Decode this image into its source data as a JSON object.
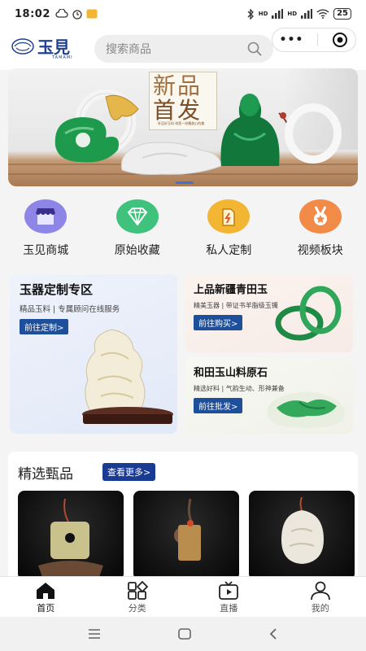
{
  "status_bar": {
    "time": "18:02",
    "battery": "25",
    "net1": "HD",
    "net2": "HD"
  },
  "header": {
    "logo_text": "玉見",
    "logo_sub": "TAMAMI",
    "search_placeholder": "搜索商品",
    "capsule_more": "•••"
  },
  "banner": {
    "title_line1": "新品",
    "title_line2": "首发",
    "tagline": "轩品好玉料 给您一份最放心的美"
  },
  "quick_nav": [
    {
      "label": "玉见商城",
      "icon": "shop-icon",
      "color": "#8d86e6"
    },
    {
      "label": "原始收藏",
      "icon": "diamond-icon",
      "color": "#3fc27b"
    },
    {
      "label": "私人定制",
      "icon": "tag-icon",
      "color": "#f2b632"
    },
    {
      "label": "视频板块",
      "icon": "medal-icon",
      "color": "#f28b47"
    }
  ],
  "promo": {
    "custom": {
      "title": "玉器定制专区",
      "desc": "精品玉料 | 专属顾问在线服务",
      "button": "前往定制>"
    },
    "qingtian": {
      "title": "上品新疆青田玉",
      "desc": "精美玉器 | 带证书羊脂级玉镯",
      "button": "前往购买>"
    },
    "hetian": {
      "title": "和田玉山料原石",
      "desc": "精选好料 | 气韵生动、形神兼备",
      "button": "前往批发>"
    }
  },
  "selection": {
    "title": "精选甄品",
    "more_button": "查看更多>"
  },
  "tabs": [
    {
      "label": "首页",
      "icon": "home-icon"
    },
    {
      "label": "分类",
      "icon": "category-icon"
    },
    {
      "label": "直播",
      "icon": "live-tv-icon"
    },
    {
      "label": "我的",
      "icon": "profile-icon"
    }
  ],
  "colors": {
    "accent_blue": "#1e4f9b",
    "more_button": "#1a3b94",
    "indicator": "#3b73d9"
  }
}
